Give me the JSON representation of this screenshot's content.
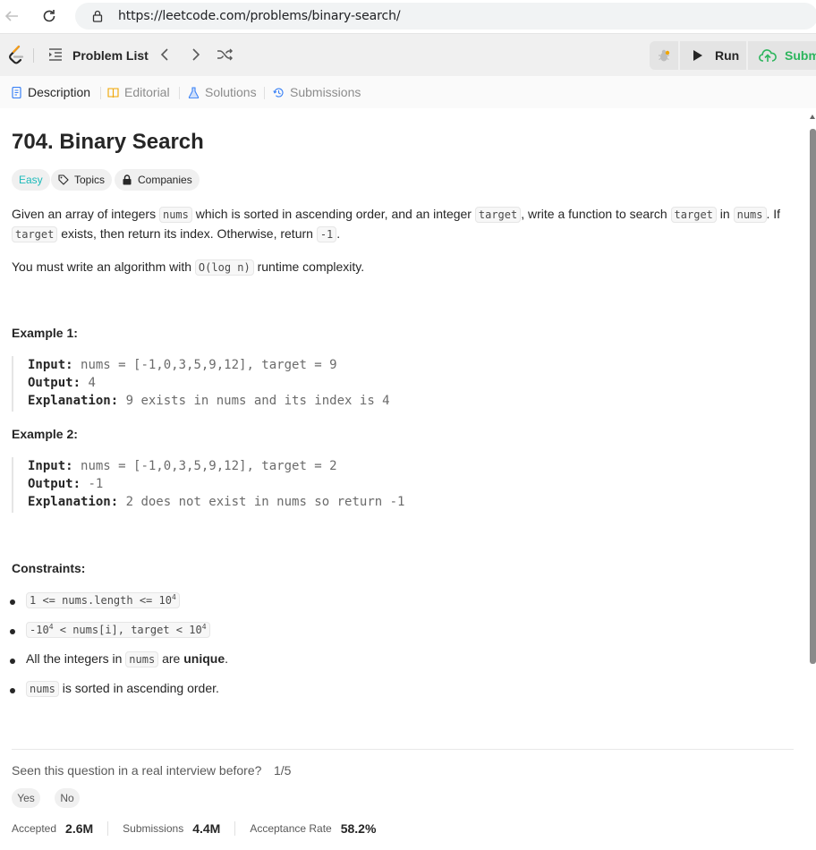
{
  "browser": {
    "url": "https://leetcode.com/problems/binary-search/"
  },
  "toolbar": {
    "problem_list": "Problem List",
    "run": "Run",
    "submit": "Subm",
    "submit_color": "#2db55d"
  },
  "tabs": {
    "description": "Description",
    "editorial": "Editorial",
    "solutions": "Solutions",
    "submissions": "Submissions"
  },
  "problem": {
    "title": "704. Binary Search",
    "difficulty": "Easy",
    "difficulty_color": "#1cbaba",
    "topics": "Topics",
    "companies": "Companies",
    "desc_1a": "Given an array of integers ",
    "desc_code_nums": "nums",
    "desc_1b": " which is sorted in ascending order, and an integer ",
    "desc_code_target": "target",
    "desc_1c": ", write a function to search ",
    "desc_1d": " in ",
    "desc_1e": ". If",
    "desc_2a": " exists, then return its index. Otherwise, return ",
    "desc_code_neg1": "-1",
    "desc_2b": ".",
    "complexity_a": "You must write an algorithm with ",
    "complexity_code": "O(log n)",
    "complexity_b": " runtime complexity."
  },
  "examples": [
    {
      "heading": "Example 1:",
      "input_label": "Input:",
      "input": "nums = [-1,0,3,5,9,12], target = 9",
      "output_label": "Output:",
      "output": "4",
      "explanation_label": "Explanation:",
      "explanation": "9 exists in nums and its index is 4"
    },
    {
      "heading": "Example 2:",
      "input_label": "Input:",
      "input": "nums = [-1,0,3,5,9,12], target = 2",
      "output_label": "Output:",
      "output": "-1",
      "explanation_label": "Explanation:",
      "explanation": "2 does not exist in nums so return -1"
    }
  ],
  "constraints": {
    "heading": "Constraints:",
    "c1_code": "1 <= nums.length <= 10",
    "c1_sup": "4",
    "c2_a": "-10",
    "c2_sup1": "4",
    "c2_b": " < nums[i], target < 10",
    "c2_sup2": "4",
    "c3_a": "All the integers in ",
    "c3_code": "nums",
    "c3_b": " are ",
    "c3_strong": "unique",
    "c3_c": ".",
    "c4_code": "nums",
    "c4_b": " is sorted in ascending order."
  },
  "feedback": {
    "question": "Seen this question in a real interview before?",
    "count": "1/5",
    "yes": "Yes",
    "no": "No"
  },
  "stats": {
    "accepted_label": "Accepted",
    "accepted_value": "2.6M",
    "submissions_label": "Submissions",
    "submissions_value": "4.4M",
    "rate_label": "Acceptance Rate",
    "rate_value": "58.2%"
  }
}
